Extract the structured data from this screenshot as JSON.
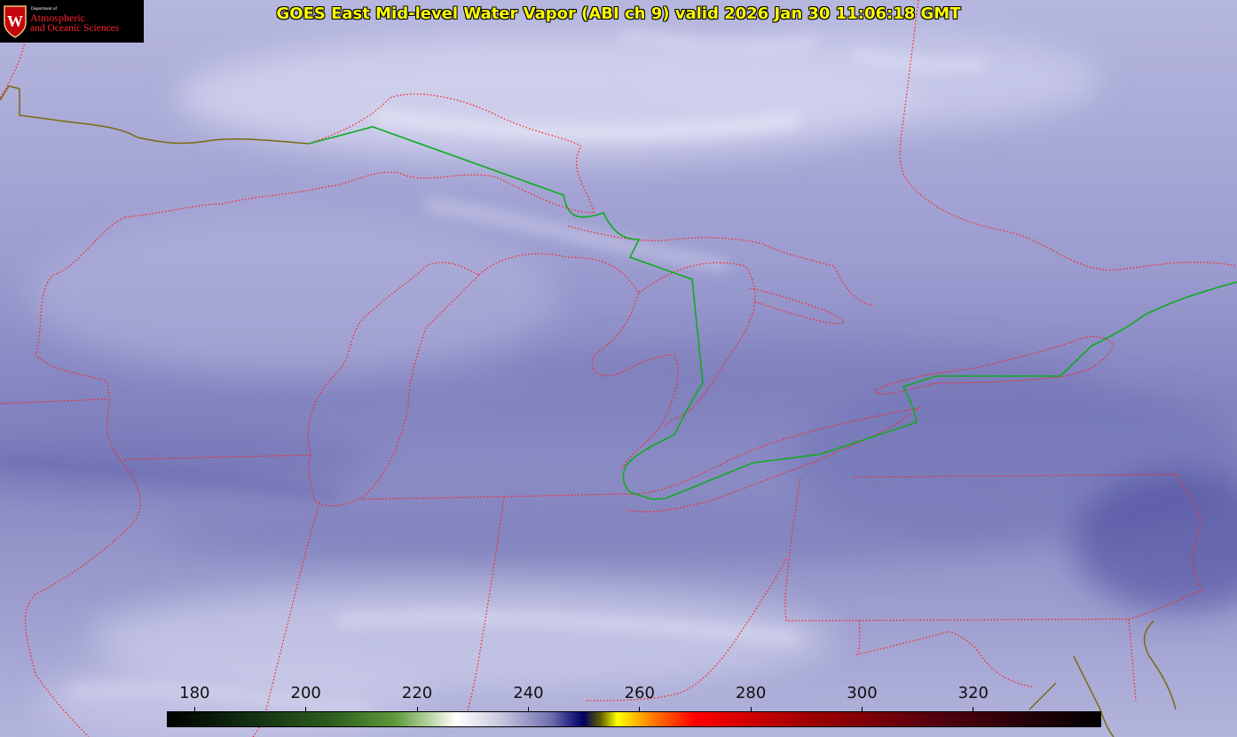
{
  "title": "GOES East Mid-level Water Vapor (ABI ch 9)  valid 2026 Jan 30 11:06:18 GMT",
  "logo": {
    "department": "Department of",
    "line1": "Atmospheric",
    "line2": "and Oceanic Sciences",
    "seal_letter": "W"
  },
  "colorbar": {
    "min": 175,
    "max": 343,
    "ticks": [
      180,
      200,
      220,
      240,
      260,
      280,
      300,
      320
    ],
    "stops": [
      {
        "v": 175,
        "color": "#000000"
      },
      {
        "v": 190,
        "color": "#123012"
      },
      {
        "v": 205,
        "color": "#2f5f1e"
      },
      {
        "v": 216,
        "color": "#5f9a3c"
      },
      {
        "v": 223,
        "color": "#c5dcb0"
      },
      {
        "v": 227,
        "color": "#ffffff"
      },
      {
        "v": 235,
        "color": "#c8c8e0"
      },
      {
        "v": 244,
        "color": "#7070b0"
      },
      {
        "v": 248,
        "color": "#202080"
      },
      {
        "v": 250,
        "color": "#000060"
      },
      {
        "v": 253,
        "color": "#606000"
      },
      {
        "v": 256,
        "color": "#ffff00"
      },
      {
        "v": 262,
        "color": "#ff8000"
      },
      {
        "v": 270,
        "color": "#ff0000"
      },
      {
        "v": 290,
        "color": "#a00000"
      },
      {
        "v": 315,
        "color": "#500010"
      },
      {
        "v": 343,
        "color": "#000000"
      }
    ]
  },
  "colors": {
    "imagery_base": "#8d8ec6",
    "state_border": "#ff2020",
    "international_border": "#11aa22",
    "title_text": "#ffff00"
  }
}
